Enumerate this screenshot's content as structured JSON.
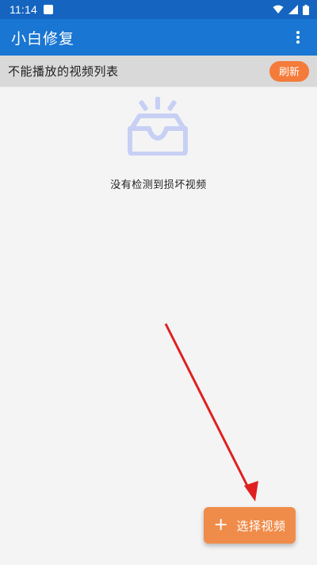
{
  "status_bar": {
    "time": "11:14",
    "icons": [
      "notification-icon",
      "wifi-icon",
      "signal-icon",
      "battery-icon"
    ]
  },
  "app_bar": {
    "title": "小白修复",
    "menu_icon": "more-vert-icon",
    "background": "#1976d2"
  },
  "list_header": {
    "label": "不能播放的视频列表",
    "refresh_label": "刷新",
    "refresh_color": "#f47b3a"
  },
  "empty_state": {
    "icon": "empty-inbox-icon",
    "message": "没有检测到损坏视频"
  },
  "fab": {
    "icon": "plus-icon",
    "label": "选择视频",
    "color": "#f08c4a"
  },
  "annotation": {
    "icon": "red-arrow",
    "color": "#e02020"
  }
}
